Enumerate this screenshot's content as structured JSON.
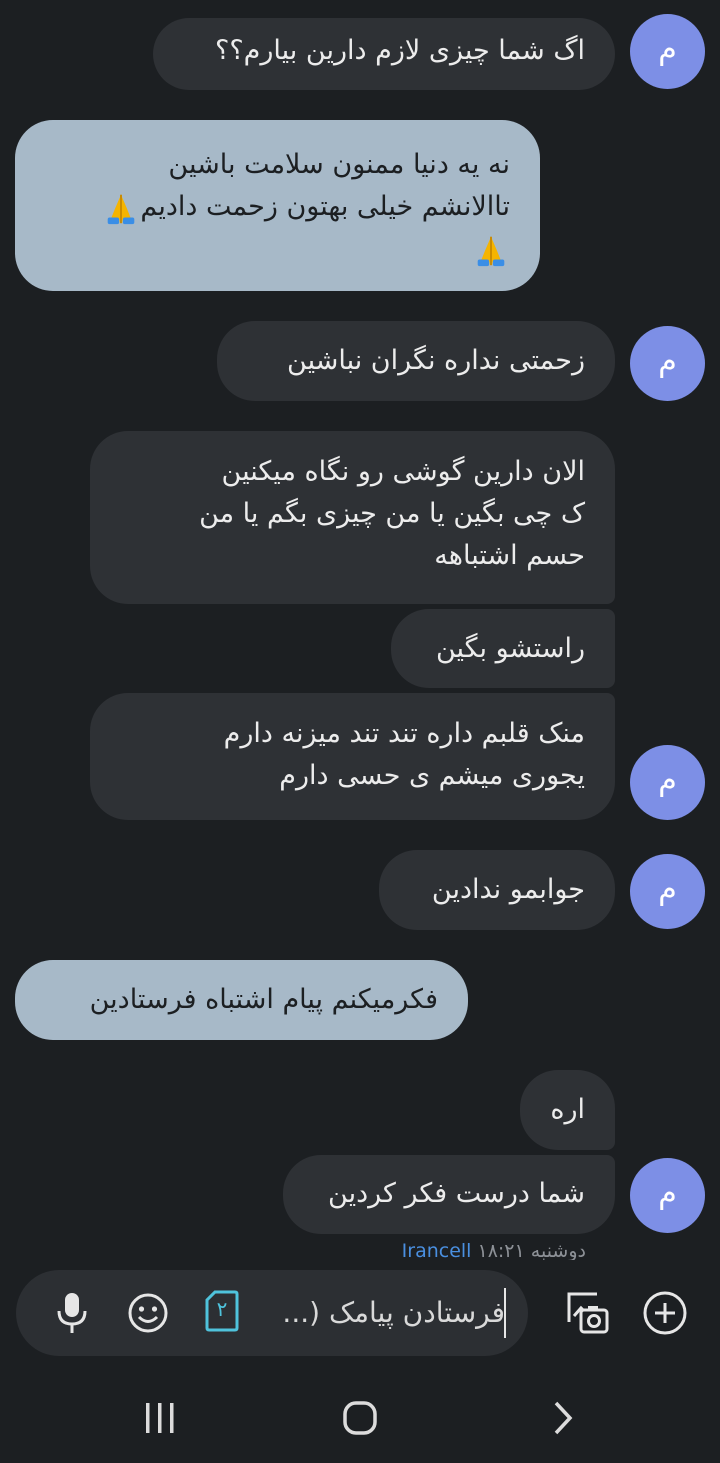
{
  "messages": [
    {
      "id": "m1",
      "dir": "in",
      "lines": [
        "اگ شما چیزی لازم دارین بیارم؟؟"
      ],
      "avatar": "م"
    },
    {
      "id": "m2",
      "dir": "out",
      "lines": [
        "نه یه دنیا ممنون سلامت باشین",
        "تاالانشم خیلی بهتون زحمت دادیم",
        ""
      ]
    },
    {
      "id": "m3",
      "dir": "in",
      "lines": [
        "زحمتی نداره نگران نباشین"
      ],
      "avatar": "م"
    },
    {
      "id": "m4",
      "dir": "in",
      "lines": [
        "الان دارین گوشی رو نگاه میکنین",
        "ک چی بگین یا من چیزی بگم یا من",
        "حسم اشتباهه"
      ]
    },
    {
      "id": "m5",
      "dir": "in",
      "lines": [
        "راستشو بگین"
      ]
    },
    {
      "id": "m6",
      "dir": "in",
      "lines": [
        "منک قلبم داره تند تند میزنه دارم",
        "یجوری میشم  ی حسی دارم"
      ],
      "avatar": "م"
    },
    {
      "id": "m7",
      "dir": "in",
      "lines": [
        "جوابمو ندادین"
      ],
      "avatar": "م"
    },
    {
      "id": "m8",
      "dir": "out",
      "lines": [
        "فکرمیکنم پیام اشتباه فرستادین"
      ]
    },
    {
      "id": "m9",
      "dir": "in",
      "lines": [
        "اره"
      ]
    },
    {
      "id": "m10",
      "dir": "in",
      "lines": [
        "شما درست فکر کردین"
      ],
      "avatar": "م"
    }
  ],
  "status": {
    "day": "دوشنبه",
    "time": "۱۸:۲۱",
    "carrier": "Irancell"
  },
  "composer": {
    "placeholder": "فرستادن پیامک (...",
    "sim_label": "۲"
  },
  "colors": {
    "background": "#1c1f22",
    "incoming_bubble": "#2e3135",
    "outgoing_bubble": "#a7b9c8",
    "avatar": "#7d8fe6",
    "sim_accent": "#4fc3dc"
  },
  "icons": [
    "mic-icon",
    "emoji-icon",
    "sim-icon",
    "gallery-camera-icon",
    "add-icon",
    "recents-icon",
    "home-icon",
    "back-icon"
  ]
}
